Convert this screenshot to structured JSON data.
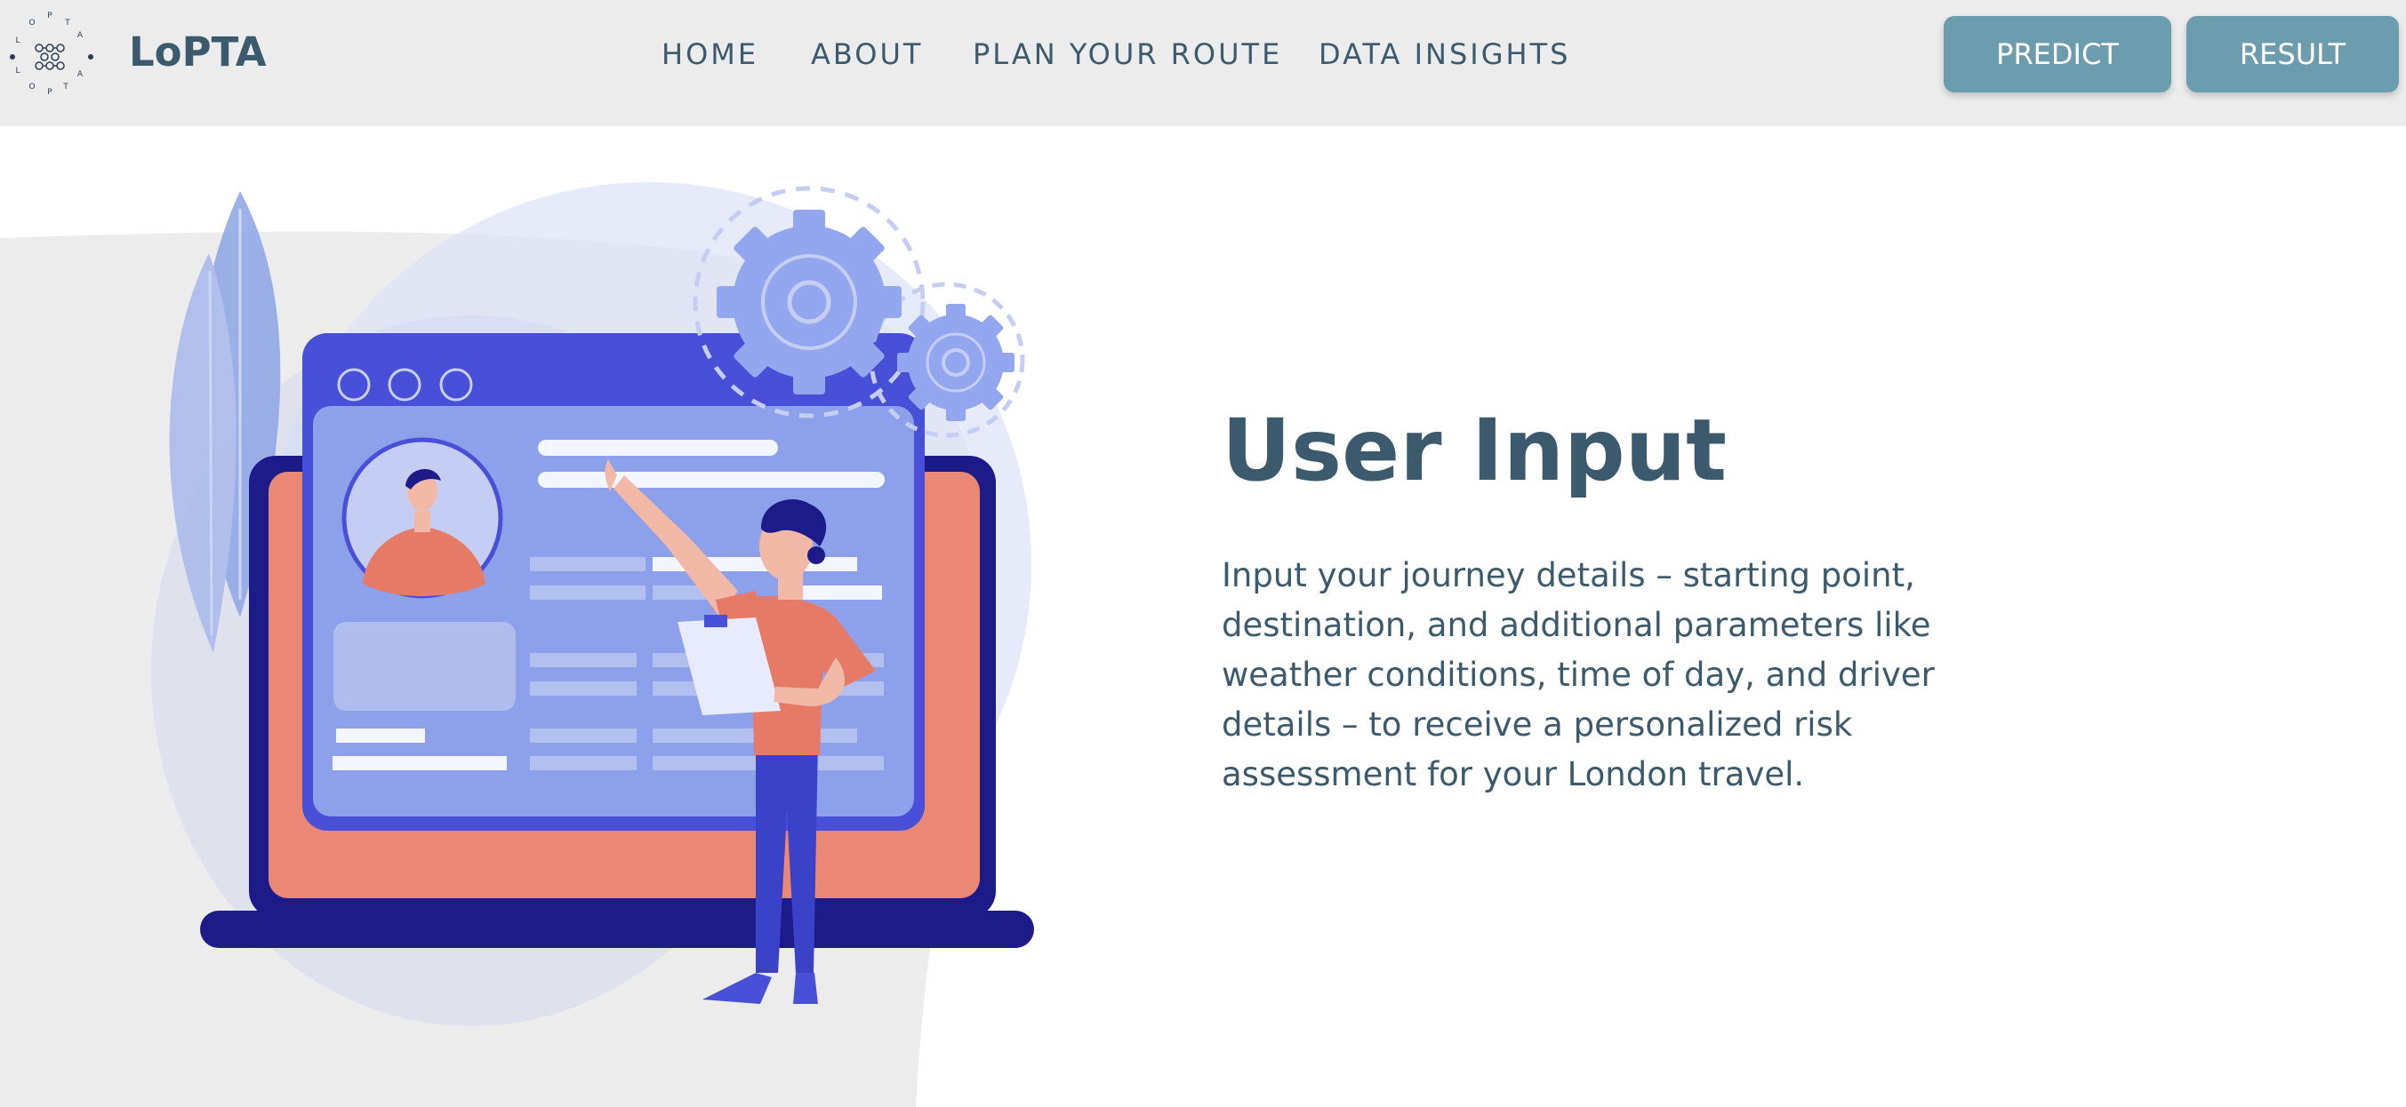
{
  "header": {
    "logo_letters": [
      "P",
      "T",
      "A",
      "O",
      "P",
      "T",
      "A",
      "L",
      "O",
      "P",
      "T",
      "A",
      "L"
    ],
    "brand": "LoPTA",
    "nav": [
      {
        "label": "HOME"
      },
      {
        "label": "ABOUT"
      },
      {
        "label": "PLAN YOUR ROUTE"
      },
      {
        "label": "DATA INSIGHTS"
      }
    ],
    "buttons": {
      "predict": "PREDICT",
      "result": "RESULT"
    }
  },
  "hero": {
    "title": "User Input",
    "description": "Input your journey details – starting point, destination, and additional parameters like weather conditions, time of day, and driver details – to receive a personalized risk assessment for your London travel."
  },
  "colors": {
    "primary_text": "#3d5a6c",
    "button_bg": "#6b9dad",
    "nav_bg": "#ececec",
    "illustration_blue": "#4a4fd8",
    "illustration_orange": "#e77a65"
  },
  "icons": [
    "logo-icon",
    "gear-icon",
    "person-illustration",
    "laptop-illustration"
  ]
}
